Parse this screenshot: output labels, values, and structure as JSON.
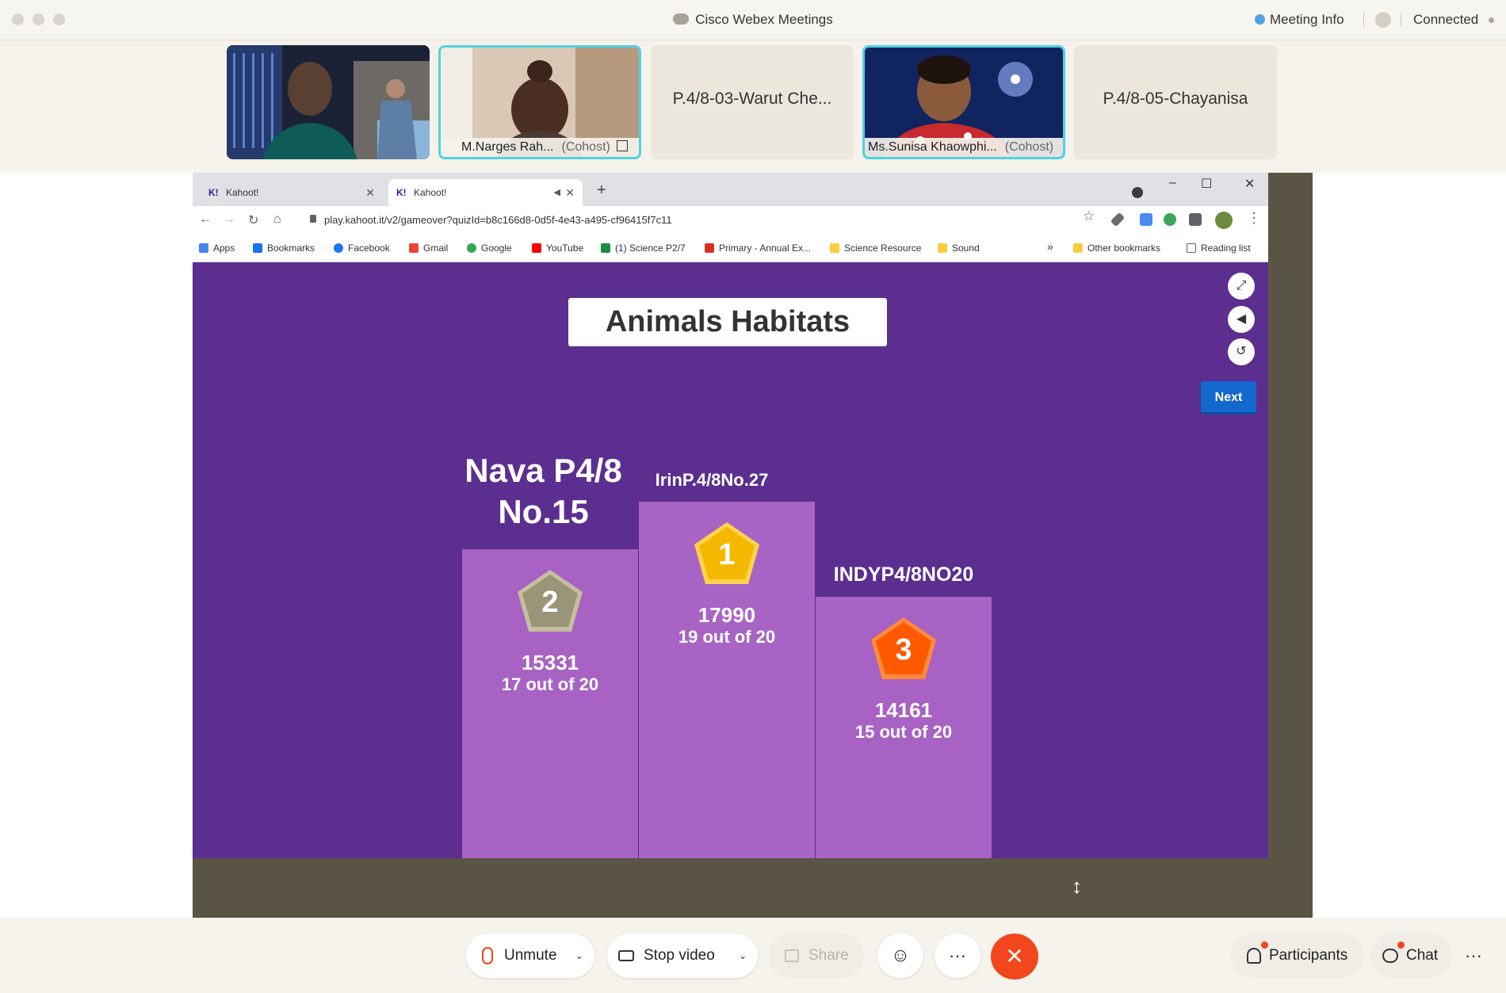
{
  "window": {
    "title": "Cisco Webex Meetings",
    "meeting_info_label": "Meeting Info",
    "connection_status": "Connected"
  },
  "participants_strip": [
    {
      "name": "",
      "cohost": "",
      "has_video": true
    },
    {
      "name": "M.Narges Rah...",
      "cohost": "(Cohost)",
      "has_video": true,
      "active": true
    },
    {
      "name": "P.4/8-03-Warut Che...",
      "cohost": "",
      "has_video": false
    },
    {
      "name": "Ms.Sunisa Khaowphi...",
      "cohost": "(Cohost)",
      "has_video": true,
      "active": true
    },
    {
      "name": "P.4/8-05-Chayanisa",
      "cohost": "",
      "has_video": false
    }
  ],
  "browser": {
    "tabs": [
      {
        "label": "Kahoot!",
        "active": false
      },
      {
        "label": "Kahoot!",
        "active": true
      }
    ],
    "url": "play.kahoot.it/v2/gameover?quizId=b8c166d8-0d5f-4e43-a495-cf96415f7c11",
    "bookmarks": [
      {
        "label": "Apps",
        "icon": "apps-grid-icon",
        "color": "#4285f4"
      },
      {
        "label": "Bookmarks",
        "icon": "star-icon",
        "color": "#1a73e8"
      },
      {
        "label": "Facebook",
        "icon": "facebook-icon",
        "color": "#1877f2"
      },
      {
        "label": "Gmail",
        "icon": "gmail-icon",
        "color": "#ea4335"
      },
      {
        "label": "Google",
        "icon": "google-icon",
        "color": "#34a853"
      },
      {
        "label": "YouTube",
        "icon": "youtube-icon",
        "color": "#ff0000"
      },
      {
        "label": "(1) Science P2/7",
        "icon": "classroom-icon",
        "color": "#1e8e3e"
      },
      {
        "label": "Primary - Annual Ex...",
        "icon": "site-icon",
        "color": "#d93025"
      },
      {
        "label": "Science Resource",
        "icon": "folder-icon",
        "color": "#f9ce3a"
      },
      {
        "label": "Sound",
        "icon": "folder-icon",
        "color": "#f9ce3a"
      }
    ],
    "overflow": "»",
    "other_bookmarks": "Other bookmarks",
    "reading_list": "Reading list"
  },
  "kahoot": {
    "quiz_title": "Animals Habitats",
    "next_label": "Next",
    "podium": [
      {
        "rank": "1",
        "name": "IrinP.4/8No.27",
        "score": "17990",
        "correct": "19 out of 20",
        "medal_color": "#f5b800"
      },
      {
        "rank": "2",
        "name_line1": "Nava P4/8",
        "name_line2": "No.15",
        "score": "15331",
        "correct": "17 out of 20",
        "medal_color": "#9a9478"
      },
      {
        "rank": "3",
        "name": "INDYP4/8NO20",
        "score": "14161",
        "correct": "15 out of 20",
        "medal_color": "#ff5a00"
      }
    ]
  },
  "controls": {
    "unmute": "Unmute",
    "stop_video": "Stop video",
    "share": "Share",
    "participants": "Participants",
    "chat": "Chat"
  }
}
